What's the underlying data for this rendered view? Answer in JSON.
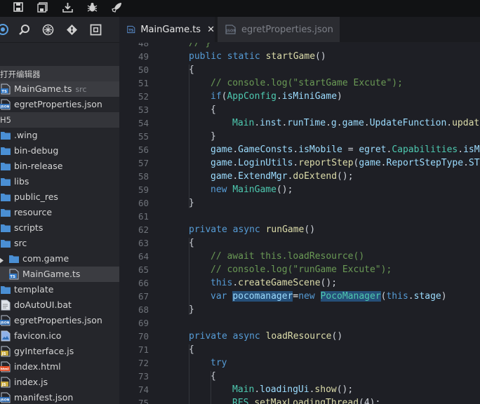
{
  "titlebar": {
    "buttons": [
      "save-icon",
      "save-all-icon",
      "download-icon",
      "bug-icon",
      "rocket-icon"
    ]
  },
  "toolbar": {
    "tools": [
      "explorer-icon",
      "search-icon",
      "extensions-icon",
      "git-icon",
      "layout-icon"
    ]
  },
  "tabs": [
    {
      "label": "MainGame.ts",
      "icon": "ts-file-icon",
      "active": true,
      "close": "✕"
    },
    {
      "label": "egretProperties.json",
      "icon": "json-file-icon",
      "active": false
    }
  ],
  "sidebar": {
    "open_editors_header": "打开编辑器",
    "open_editors": [
      {
        "label": "MainGame.ts",
        "desc": "src",
        "icon": "ts"
      },
      {
        "label": "egretProperties.json",
        "desc": "",
        "icon": "json"
      }
    ],
    "project_header": "H5",
    "tree": [
      {
        "label": ".wing",
        "type": "folder"
      },
      {
        "label": "bin-debug",
        "type": "folder"
      },
      {
        "label": "bin-release",
        "type": "folder"
      },
      {
        "label": "libs",
        "type": "folder"
      },
      {
        "label": "public_res",
        "type": "folder"
      },
      {
        "label": "resource",
        "type": "folder"
      },
      {
        "label": "scripts",
        "type": "folder"
      },
      {
        "label": "src",
        "type": "folder"
      },
      {
        "label": "com.game",
        "type": "folder-child"
      },
      {
        "label": "MainGame.ts",
        "type": "ts-child"
      },
      {
        "label": "template",
        "type": "folder"
      },
      {
        "label": "doAutoUI.bat",
        "type": "file"
      },
      {
        "label": "egretProperties.json",
        "type": "json"
      },
      {
        "label": "favicon.ico",
        "type": "image"
      },
      {
        "label": "gyInterface.js",
        "type": "js"
      },
      {
        "label": "index.html",
        "type": "html"
      },
      {
        "label": "index.js",
        "type": "js"
      },
      {
        "label": "manifest.json",
        "type": "json"
      }
    ]
  },
  "editor": {
    "lines": [
      {
        "n": "48",
        "i": 0,
        "t": [
          [
            "cm",
            "// }"
          ]
        ]
      },
      {
        "n": "49",
        "i": 0,
        "t": [
          [
            "kw",
            "public"
          ],
          [
            "",
            " "
          ],
          [
            "kw",
            "static"
          ],
          [
            "",
            " "
          ],
          [
            "fn",
            "startGame"
          ],
          [
            "",
            "()"
          ]
        ]
      },
      {
        "n": "50",
        "i": 0,
        "t": [
          [
            "",
            "{"
          ]
        ]
      },
      {
        "n": "51",
        "i": 1,
        "t": [
          [
            "cm",
            "// console.log(\"startGame Excute\");"
          ]
        ]
      },
      {
        "n": "52",
        "i": 1,
        "t": [
          [
            "kw",
            "if"
          ],
          [
            "",
            "("
          ],
          [
            "cls",
            "AppConfig"
          ],
          [
            "",
            "."
          ],
          [
            "prm",
            "isMiniGame"
          ],
          [
            "",
            ")"
          ]
        ]
      },
      {
        "n": "53",
        "i": 1,
        "t": [
          [
            "",
            "{"
          ]
        ]
      },
      {
        "n": "54",
        "i": 2,
        "t": [
          [
            "cls",
            "Main"
          ],
          [
            "",
            "."
          ],
          [
            "prm",
            "inst"
          ],
          [
            "",
            "."
          ],
          [
            "prm",
            "runTime"
          ],
          [
            "",
            "."
          ],
          [
            "prm",
            "g"
          ],
          [
            "",
            "."
          ],
          [
            "prm",
            "game"
          ],
          [
            "",
            "."
          ],
          [
            "prm",
            "UpdateFunction"
          ],
          [
            "",
            "."
          ],
          [
            "fn",
            "update"
          ]
        ]
      },
      {
        "n": "55",
        "i": 1,
        "t": [
          [
            "",
            "}"
          ]
        ]
      },
      {
        "n": "56",
        "i": 1,
        "t": [
          [
            "prm",
            "game"
          ],
          [
            "",
            "."
          ],
          [
            "prm",
            "GameConsts"
          ],
          [
            "",
            "."
          ],
          [
            "prm",
            "isMobile"
          ],
          [
            "",
            " = "
          ],
          [
            "prm",
            "egret"
          ],
          [
            "",
            "."
          ],
          [
            "cls",
            "Capabilities"
          ],
          [
            "",
            "."
          ],
          [
            "prm",
            "isMo"
          ]
        ]
      },
      {
        "n": "57",
        "i": 1,
        "t": [
          [
            "prm",
            "game"
          ],
          [
            "",
            "."
          ],
          [
            "prm",
            "LoginUtils"
          ],
          [
            "",
            "."
          ],
          [
            "fn",
            "reportStep"
          ],
          [
            "",
            "("
          ],
          [
            "prm",
            "game"
          ],
          [
            "",
            "."
          ],
          [
            "prm",
            "ReportStepType"
          ],
          [
            "",
            "."
          ],
          [
            "prm",
            "STE"
          ]
        ]
      },
      {
        "n": "58",
        "i": 1,
        "t": [
          [
            "prm",
            "game"
          ],
          [
            "",
            "."
          ],
          [
            "prm",
            "ExtendMgr"
          ],
          [
            "",
            "."
          ],
          [
            "fn",
            "doExtend"
          ],
          [
            "",
            "();"
          ]
        ]
      },
      {
        "n": "59",
        "i": 1,
        "t": [
          [
            "kw",
            "new"
          ],
          [
            "",
            " "
          ],
          [
            "cls",
            "MainGame"
          ],
          [
            "",
            "();"
          ]
        ]
      },
      {
        "n": "60",
        "i": 0,
        "t": [
          [
            "",
            "}"
          ]
        ]
      },
      {
        "n": "61",
        "i": 0,
        "t": []
      },
      {
        "n": "62",
        "i": 0,
        "t": [
          [
            "kw",
            "private"
          ],
          [
            "",
            " "
          ],
          [
            "kw",
            "async"
          ],
          [
            "",
            " "
          ],
          [
            "fn",
            "runGame"
          ],
          [
            "",
            "()"
          ]
        ]
      },
      {
        "n": "63",
        "i": 0,
        "t": [
          [
            "",
            "{"
          ]
        ]
      },
      {
        "n": "64",
        "i": 1,
        "t": [
          [
            "cm",
            "// await this.loadResource()"
          ]
        ]
      },
      {
        "n": "65",
        "i": 1,
        "t": [
          [
            "cm",
            "// console.log(\"runGame Excute\");"
          ]
        ]
      },
      {
        "n": "66",
        "i": 1,
        "t": [
          [
            "kw",
            "this"
          ],
          [
            "",
            "."
          ],
          [
            "fn",
            "createGameScene"
          ],
          [
            "",
            "();"
          ]
        ]
      },
      {
        "n": "67",
        "i": 1,
        "t": [
          [
            "kw",
            "var"
          ],
          [
            "",
            " "
          ],
          [
            "prm hl",
            "pocomanager"
          ],
          [
            "op",
            "="
          ],
          [
            "kw",
            "new"
          ],
          [
            "",
            " "
          ],
          [
            "cls hl",
            "PocoManager"
          ],
          [
            "",
            "("
          ],
          [
            "kw",
            "this"
          ],
          [
            "",
            "."
          ],
          [
            "prm",
            "stage"
          ],
          [
            "",
            ")"
          ]
        ]
      },
      {
        "n": "68",
        "i": 0,
        "t": [
          [
            "",
            "}"
          ]
        ]
      },
      {
        "n": "69",
        "i": 0,
        "t": []
      },
      {
        "n": "70",
        "i": 0,
        "t": [
          [
            "kw",
            "private"
          ],
          [
            "",
            " "
          ],
          [
            "kw",
            "async"
          ],
          [
            "",
            " "
          ],
          [
            "fn",
            "loadResource"
          ],
          [
            "",
            "()"
          ]
        ]
      },
      {
        "n": "71",
        "i": 0,
        "t": [
          [
            "",
            "{"
          ]
        ]
      },
      {
        "n": "72",
        "i": 1,
        "t": [
          [
            "kw",
            "try"
          ]
        ]
      },
      {
        "n": "73",
        "i": 1,
        "t": [
          [
            "",
            "{"
          ]
        ]
      },
      {
        "n": "74",
        "i": 2,
        "t": [
          [
            "cls",
            "Main"
          ],
          [
            "",
            "."
          ],
          [
            "prm",
            "loadingUi"
          ],
          [
            "",
            "."
          ],
          [
            "fn",
            "show"
          ],
          [
            "",
            "();"
          ]
        ]
      },
      {
        "n": "75",
        "i": 2,
        "t": [
          [
            "cls",
            "RES"
          ],
          [
            "",
            "."
          ],
          [
            "fn",
            "setMaxLoadingThread"
          ],
          [
            "",
            "(4);"
          ]
        ]
      }
    ]
  },
  "colors": {
    "accent": "#569cd6",
    "folder": "#4a8fd4",
    "ts_badge": "#3178c6",
    "json_badge": "#2f6db5",
    "js_badge": "#c8a93c",
    "html_badge": "#e44d26"
  }
}
